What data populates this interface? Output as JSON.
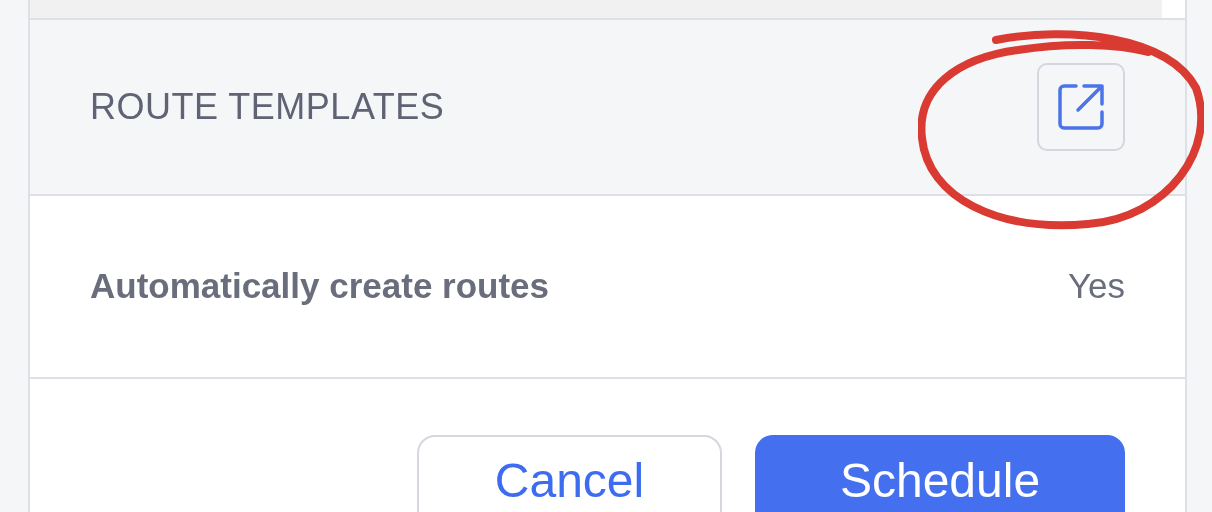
{
  "section": {
    "title": "ROUTE TEMPLATES"
  },
  "settings": [
    {
      "label": "Automatically create routes",
      "value": "Yes"
    }
  ],
  "buttons": [
    {
      "label": "Cancel",
      "kind": "secondary"
    },
    {
      "label": "Schedule",
      "kind": "primary"
    }
  ]
}
